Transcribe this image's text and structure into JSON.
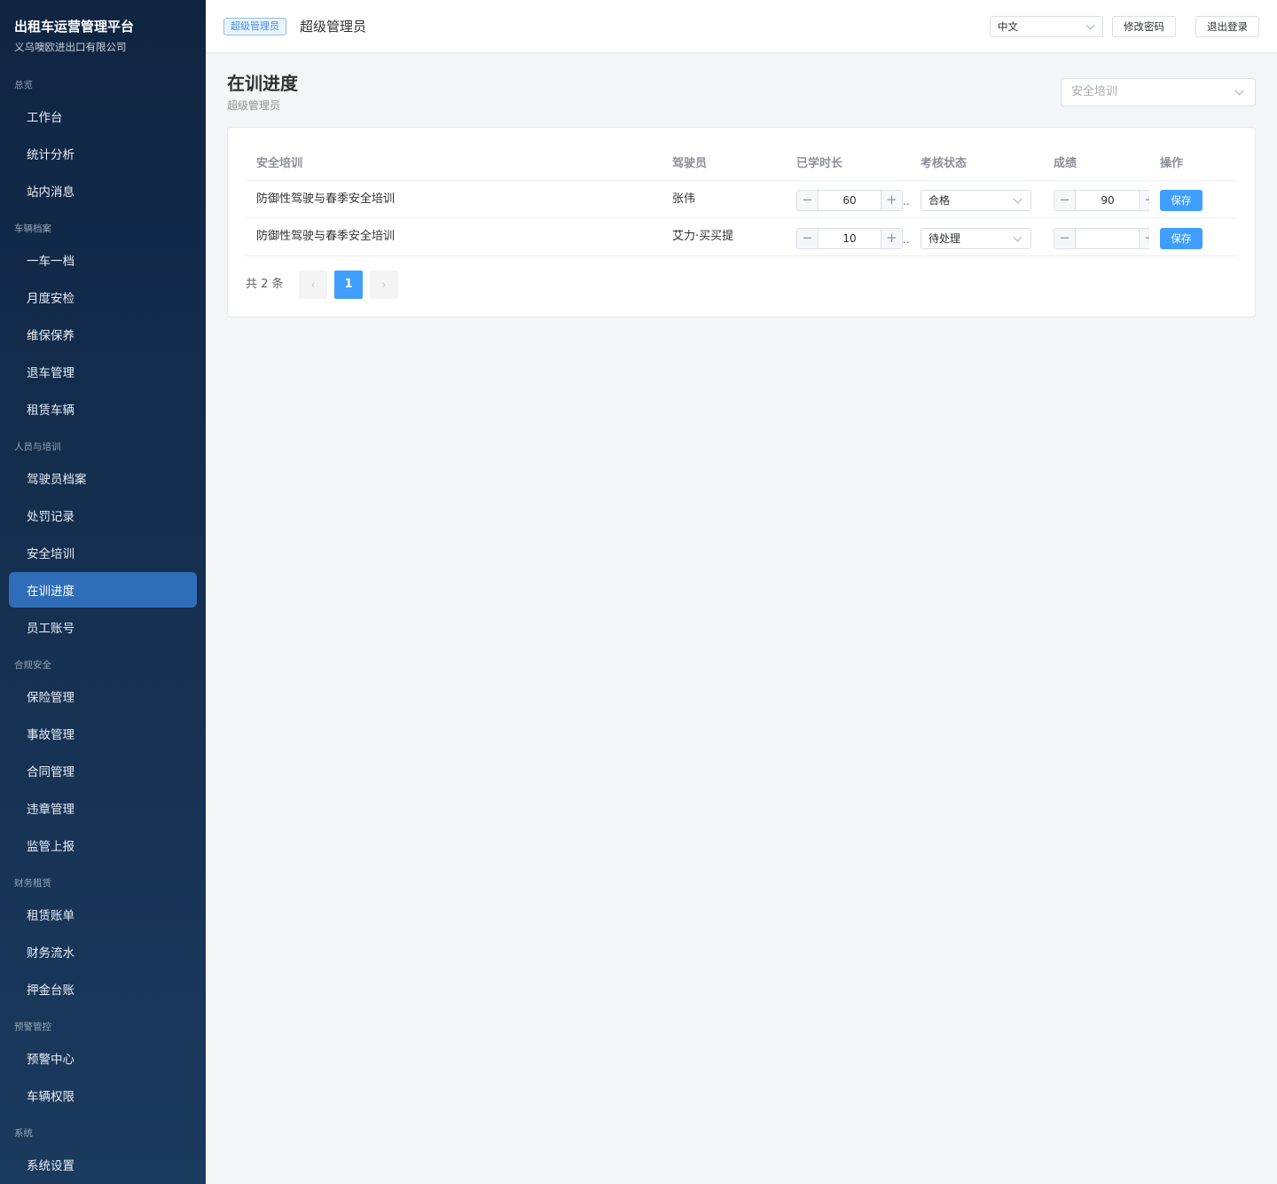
{
  "brand": {
    "title": "出租车运营管理平台",
    "subtitle": "义乌噢欧进出口有限公司"
  },
  "sidebar": {
    "groups": [
      {
        "title": "总览",
        "items": [
          "工作台",
          "统计分析",
          "站内消息"
        ]
      },
      {
        "title": "车辆档案",
        "items": [
          "一车一档",
          "月度安检",
          "维保保养",
          "退车管理",
          "租赁车辆"
        ]
      },
      {
        "title": "人员与培训",
        "items": [
          "驾驶员档案",
          "处罚记录",
          "安全培训",
          "在训进度",
          "员工账号"
        ]
      },
      {
        "title": "合规安全",
        "items": [
          "保险管理",
          "事故管理",
          "合同管理",
          "违章管理",
          "监管上报"
        ]
      },
      {
        "title": "财务租赁",
        "items": [
          "租赁账单",
          "财务流水",
          "押金台账"
        ]
      },
      {
        "title": "预警管控",
        "items": [
          "预警中心",
          "车辆权限"
        ]
      },
      {
        "title": "系统",
        "items": [
          "系统设置"
        ]
      }
    ],
    "active_item": "在训进度"
  },
  "header": {
    "role_tag": "超级管理员",
    "user_name": "超级管理员",
    "language": "中文",
    "change_password": "修改密码",
    "logout": "退出登录"
  },
  "page": {
    "title": "在训进度",
    "subtitle": "超级管理员",
    "filter_value": "安全培训"
  },
  "table": {
    "columns": [
      "安全培训",
      "驾驶员",
      "已学时长",
      "考核状态",
      "成绩",
      "操作"
    ],
    "rows": [
      {
        "training": "防御性驾驶与春季安全培训",
        "driver": "张伟",
        "hours": "60",
        "status": "合格",
        "score": "90",
        "action": "保存"
      },
      {
        "training": "防御性驾驶与春季安全培训",
        "driver": "艾力·买买提",
        "hours": "10",
        "status": "待处理",
        "score": "",
        "action": "保存"
      }
    ],
    "stepper_minus": "−",
    "stepper_plus": "+",
    "truncation": ".."
  },
  "pagination": {
    "total_text": "共 2 条",
    "current_page": "1",
    "prev": "‹",
    "next": "›"
  },
  "colors": {
    "sidebar_bg": "#0f2542",
    "active_nav": "#2f6db8",
    "primary": "#409eff"
  }
}
